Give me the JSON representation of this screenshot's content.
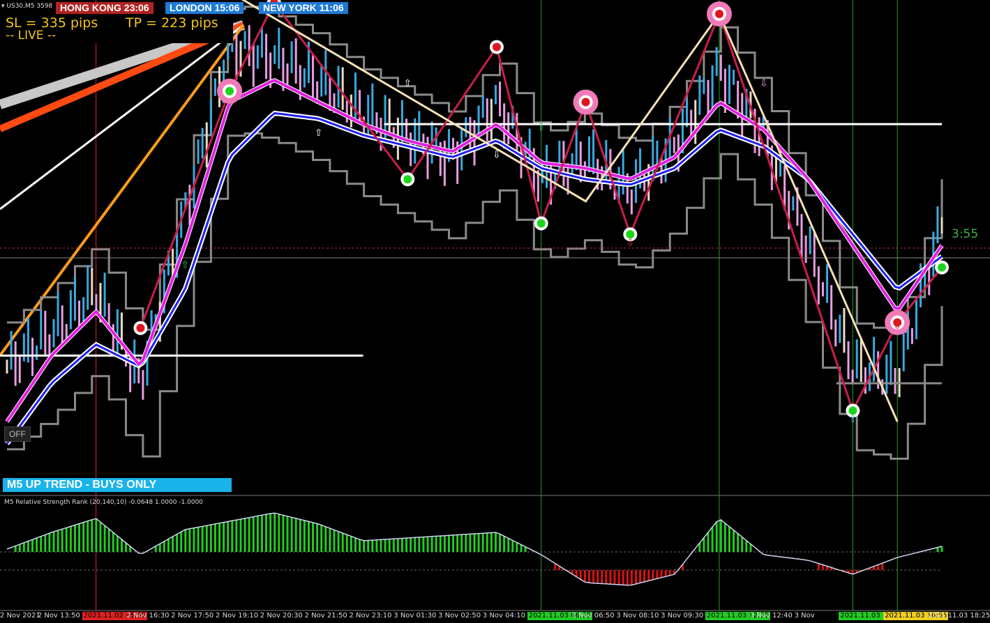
{
  "window": {
    "symbol_label": "US30,M5",
    "symbol_suffix": "3598"
  },
  "sessions": [
    {
      "label": "HONG KONG 23:06",
      "color": "#b22222"
    },
    {
      "label": "LONDON   15:06",
      "color": "#1e7bd7"
    },
    {
      "label": "NEW YORK  11:06",
      "color": "#1e7bd7"
    }
  ],
  "panel": {
    "sl_text": "SL = 335 pips",
    "tp_text": "TP = 223 pips",
    "live_text": "-- LIVE --",
    "off_button": "OFF",
    "trend_banner": "M5 UP TREND - BUYS ONLY",
    "bar_timer": "3:55"
  },
  "colors": {
    "bull": "#39a9e0",
    "bear": "#e79ee0",
    "neutral": "#e8dcc4",
    "ma_fast": "#e020e0",
    "ma_slow": "#2020f0",
    "envelope": "#8a8a8a",
    "zigzag": "#c81e4a",
    "osc_pos": "#22cc22",
    "osc_neg": "#dd1111"
  },
  "chart_data": [
    {
      "type": "line",
      "title": "US30 M5",
      "x": [
        "2 Nov 2021",
        "2 Nov 13:50",
        "2021.11.02 15:55",
        "2 Nov 16:30",
        "2 Nov 17:50",
        "2 Nov 19:10",
        "2 Nov 20:30",
        "2 Nov 21:50",
        "2 Nov 23:10",
        "3 Nov 01:30",
        "3 Nov 02:50",
        "3 Nov 04:10",
        "2021.11.03 06:25",
        "3 Nov 06:50",
        "3 Nov 08:10",
        "3 Nov 09:30",
        "2021.11.03 12:25",
        "3 Nov 12:40",
        "3 Nov",
        "2021.11.03 15:25",
        "2021.11.03 16:55",
        "2021.11.03 18:25"
      ],
      "series": [
        {
          "name": "price",
          "values": [
            36010,
            36040,
            36080,
            35995,
            36150,
            36300,
            36290,
            36270,
            36240,
            36220,
            36200,
            36250,
            36180,
            36200,
            36170,
            36210,
            36280,
            36220,
            36120,
            36010,
            36000,
            36140
          ]
        },
        {
          "name": "fast_ma",
          "values": [
            35960,
            36020,
            36060,
            36010,
            36120,
            36250,
            36270,
            36250,
            36230,
            36215,
            36205,
            36230,
            36195,
            36190,
            36180,
            36200,
            36250,
            36225,
            36180,
            36120,
            36060,
            36120
          ]
        },
        {
          "name": "slow_ma",
          "values": [
            35940,
            35995,
            36030,
            36010,
            36080,
            36200,
            36240,
            36235,
            36220,
            36210,
            36200,
            36215,
            36190,
            36180,
            36175,
            36190,
            36225,
            36210,
            36180,
            36130,
            36080,
            36110
          ]
        }
      ],
      "levels": [
        36230,
        36020
      ],
      "session_lines": [
        "2021.11.02 15:55",
        "2021.11.03 06:25",
        "2021.11.03 12:25",
        "2021.11.03 15:25",
        "2021.11.03 16:55"
      ],
      "grid": false
    },
    {
      "type": "bar",
      "title": "M5 Relative Strength Rank (20,140,10) -0.0648 1.0000 -1.0000",
      "params": [
        20,
        140,
        10
      ],
      "values_shown": [
        -0.0648,
        1.0,
        -1.0
      ],
      "series": [
        {
          "name": "rank",
          "values": [
            0.05,
            0.35,
            0.6,
            -0.05,
            0.4,
            0.55,
            0.7,
            0.5,
            0.2,
            0.25,
            0.3,
            0.35,
            -0.05,
            -0.55,
            -0.6,
            -0.4,
            0.6,
            -0.05,
            -0.15,
            -0.4,
            -0.1,
            0.1
          ]
        }
      ],
      "ylim": [
        -1,
        1
      ]
    }
  ]
}
